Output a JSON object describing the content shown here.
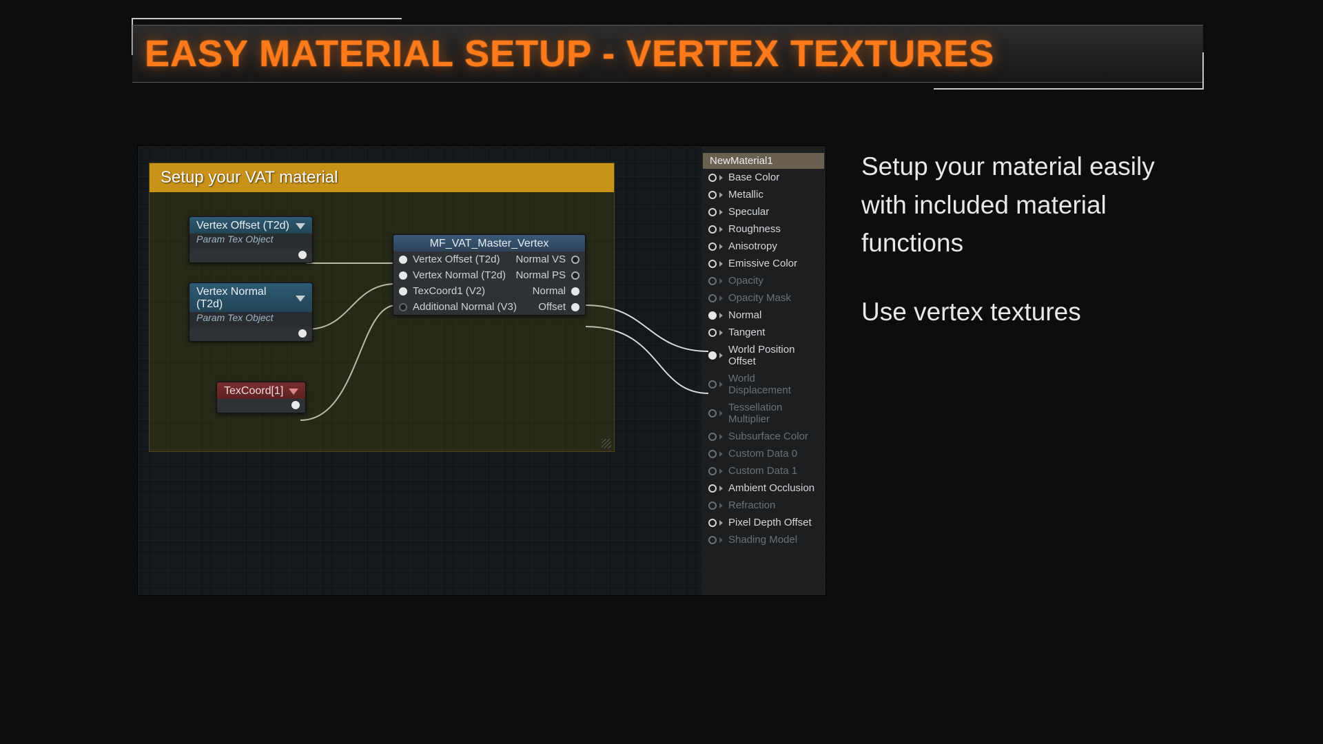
{
  "title": "EASY MATERIAL SETUP - VERTEX TEXTURES",
  "side": {
    "p1": "Setup your material easily with included material functions",
    "p2": "Use vertex textures"
  },
  "comment": {
    "title": "Setup your VAT material"
  },
  "nodes": {
    "vertexOffset": {
      "title": "Vertex Offset (T2d)",
      "sub": "Param Tex Object"
    },
    "vertexNormal": {
      "title": "Vertex Normal (T2d)",
      "sub": "Param Tex Object"
    },
    "texcoord": {
      "title": "TexCoord[1]"
    },
    "func": {
      "title": "MF_VAT_Master_Vertex",
      "in": [
        "Vertex Offset (T2d)",
        "Vertex Normal (T2d)",
        "TexCoord1 (V2)",
        "Additional Normal (V3)"
      ],
      "out": [
        "Normal VS",
        "Normal PS",
        "Normal",
        "Offset"
      ]
    }
  },
  "material": {
    "title": "NewMaterial1",
    "pins": [
      {
        "label": "Base Color",
        "enabled": true,
        "connected": false
      },
      {
        "label": "Metallic",
        "enabled": true,
        "connected": false
      },
      {
        "label": "Specular",
        "enabled": true,
        "connected": false
      },
      {
        "label": "Roughness",
        "enabled": true,
        "connected": false
      },
      {
        "label": "Anisotropy",
        "enabled": true,
        "connected": false
      },
      {
        "label": "Emissive Color",
        "enabled": true,
        "connected": false
      },
      {
        "label": "Opacity",
        "enabled": false,
        "connected": false
      },
      {
        "label": "Opacity Mask",
        "enabled": false,
        "connected": false
      },
      {
        "label": "Normal",
        "enabled": true,
        "connected": true
      },
      {
        "label": "Tangent",
        "enabled": true,
        "connected": false
      },
      {
        "label": "World Position Offset",
        "enabled": true,
        "connected": true
      },
      {
        "label": "World Displacement",
        "enabled": false,
        "connected": false
      },
      {
        "label": "Tessellation Multiplier",
        "enabled": false,
        "connected": false
      },
      {
        "label": "Subsurface Color",
        "enabled": false,
        "connected": false
      },
      {
        "label": "Custom Data 0",
        "enabled": false,
        "connected": false
      },
      {
        "label": "Custom Data 1",
        "enabled": false,
        "connected": false
      },
      {
        "label": "Ambient Occlusion",
        "enabled": true,
        "connected": false
      },
      {
        "label": "Refraction",
        "enabled": false,
        "connected": false
      },
      {
        "label": "Pixel Depth Offset",
        "enabled": true,
        "connected": false
      },
      {
        "label": "Shading Model",
        "enabled": false,
        "connected": false
      }
    ]
  }
}
